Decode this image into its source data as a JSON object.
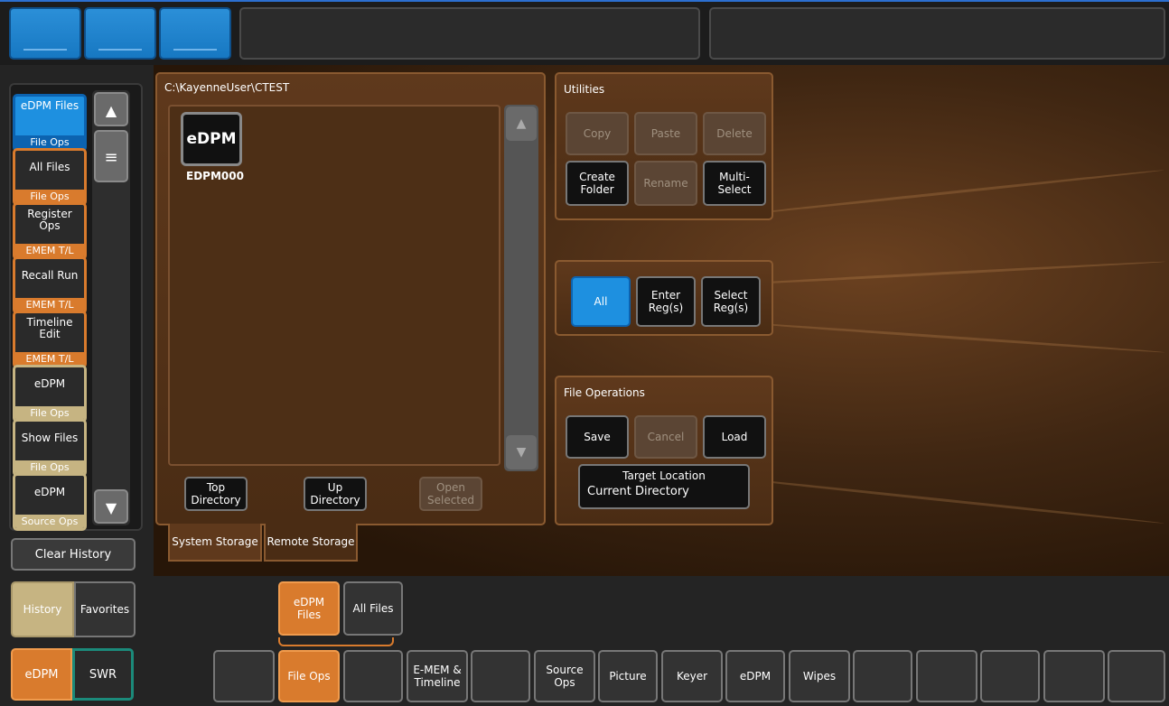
{
  "history_panel": {
    "items": [
      {
        "title": "eDPM Files",
        "sub": "File Ops",
        "style": "blue"
      },
      {
        "title": "All Files",
        "sub": "File Ops",
        "style": "orange"
      },
      {
        "title": "Register Ops",
        "sub": "EMEM T/L",
        "style": "orange"
      },
      {
        "title": "Recall Run",
        "sub": "EMEM T/L",
        "style": "orange"
      },
      {
        "title": "Timeline Edit",
        "sub": "EMEM T/L",
        "style": "orange"
      },
      {
        "title": "eDPM",
        "sub": "File Ops",
        "style": "tan"
      },
      {
        "title": "Show Files",
        "sub": "File Ops",
        "style": "tan"
      },
      {
        "title": "eDPM",
        "sub": "Source Ops",
        "style": "tan"
      }
    ],
    "clear_history_label": "Clear History",
    "history_tab_label": "History",
    "favorites_tab_label": "Favorites"
  },
  "mode_buttons": {
    "edpm_label": "eDPM",
    "swr_label": "SWR"
  },
  "file_browser": {
    "path": "C:\\KayenneUser\\CTEST",
    "file_icon_text": "eDPM",
    "file_name": "EDPM000",
    "top_directory_label": "Top Directory",
    "up_directory_label": "Up Directory",
    "open_selected_label": "Open Selected",
    "system_storage_tab": "System Storage",
    "remote_storage_tab": "Remote Storage"
  },
  "utilities": {
    "title": "Utilities",
    "copy": "Copy",
    "paste": "Paste",
    "delete": "Delete",
    "create_folder": "Create Folder",
    "rename": "Rename",
    "multi_select": "Multi-Select"
  },
  "register_select": {
    "all": "All",
    "enter_regs": "Enter Reg(s)",
    "select_regs": "Select Reg(s)"
  },
  "file_operations": {
    "title": "File Operations",
    "save": "Save",
    "cancel": "Cancel",
    "load": "Load",
    "target_location_label": "Target Location",
    "target_location_value": "Current Directory"
  },
  "sub_tabs": {
    "edpm_files": "eDPM Files",
    "all_files": "All Files"
  },
  "bottom_tabs": [
    "",
    "File Ops",
    "",
    "E-MEM & Timeline",
    "",
    "Source Ops",
    "Picture",
    "Keyer",
    "eDPM",
    "Wipes",
    "",
    "",
    "",
    "",
    "",
    ""
  ],
  "colors": {
    "accent_orange": "#d97b2d",
    "accent_blue": "#1e90e0",
    "tan": "#c6b482"
  }
}
